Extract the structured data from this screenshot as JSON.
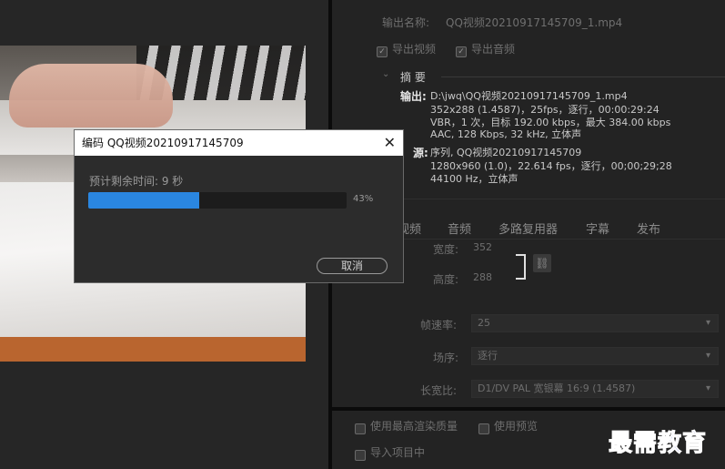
{
  "right_panel": {
    "output_name_label": "输出名称:",
    "output_name_value": "QQ视频20210917145709_1.mp4",
    "export_video_label": "导出视频",
    "export_audio_label": "导出音频",
    "summary_label": "摘 要",
    "output_label": "输出:",
    "output_lines": [
      "D:\\jwq\\QQ视频20210917145709_1.mp4",
      "352x288 (1.4587)，25fps，逐行，00:00:29:24",
      "VBR，1 次，目标 192.00 kbps，最大 384.00 kbps",
      "AAC, 128 Kbps, 32  kHz, 立体声"
    ],
    "source_label": "源:",
    "source_lines": [
      "序列, QQ视频20210917145709",
      "1280x960 (1.0)，22.614 fps，逐行，00;00;29;28",
      "44100 Hz，立体声"
    ],
    "tabs": [
      "视频",
      "音频",
      "多路复用器",
      "字幕",
      "发布"
    ],
    "width_label": "宽度:",
    "width_value": "352",
    "height_label": "高度:",
    "height_value": "288",
    "frame_rate_label": "帧速率:",
    "frame_rate_value": "25",
    "field_order_label": "场序:",
    "field_order_value": "逐行",
    "aspect_label": "长宽比:",
    "aspect_value": "D1/DV PAL 宽银幕 16:9 (1.4587)"
  },
  "bottom_panel": {
    "max_render_quality_label": "使用最高渲染质量",
    "use_previews_label": "使用预览",
    "import_project_label": "导入项目中"
  },
  "dialog": {
    "title": "编码 QQ视频20210917145709",
    "remaining_label": "预计剩余时间: 9 秒",
    "progress": 0.43,
    "progress_text": "43%",
    "cancel_label": "取消",
    "close_icon": "✕"
  },
  "watermark": "最需教育",
  "colors": {
    "progress_fill": "#2a86e0",
    "watermark": "#1f2bb6"
  }
}
